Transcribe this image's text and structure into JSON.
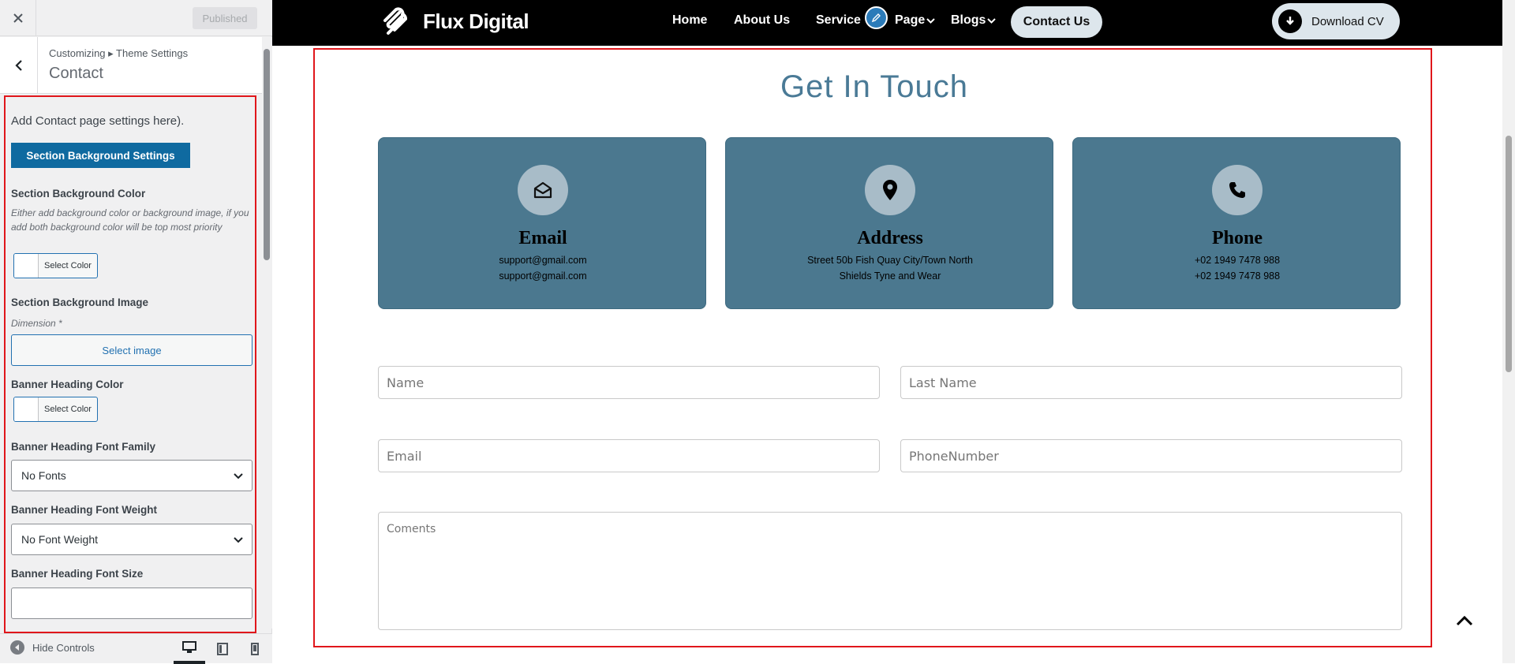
{
  "sidebar": {
    "close_icon": "close-icon",
    "published_label": "Published",
    "breadcrumb": "Customizing ▸ Theme Settings",
    "section_title": "Contact",
    "intro": "Add Contact page settings here).",
    "bg_settings_button": "Section Background Settings",
    "bg_color_label": "Section Background Color",
    "bg_color_desc": "Either add background color or background image, if you add both background color will be top most priority",
    "select_color": "Select Color",
    "bg_image_label": "Section Background Image",
    "dimension_label": "Dimension *",
    "select_image": "Select image",
    "heading_color_label": "Banner Heading Color",
    "font_family_label": "Banner Heading Font Family",
    "font_family_value": "No Fonts",
    "font_weight_label": "Banner Heading Font Weight",
    "font_weight_value": "No Font Weight",
    "font_size_label": "Banner Heading Font Size",
    "font_size_value": "",
    "hide_controls": "Hide Controls"
  },
  "nav": {
    "logo_text": "Flux Digital",
    "links": [
      "Home",
      "About Us",
      "Service",
      "Page",
      "Blogs"
    ],
    "contact": "Contact Us",
    "download": "Download CV"
  },
  "section": {
    "title": "Get In Touch",
    "cards": [
      {
        "icon": "envelope-open-icon",
        "title": "Email",
        "line1": "support@gmail.com",
        "line2": "support@gmail.com"
      },
      {
        "icon": "map-pin-icon",
        "title": "Address",
        "line1": "Street 50b Fish Quay City/Town North",
        "line2": "Shields Tyne and Wear"
      },
      {
        "icon": "phone-icon",
        "title": "Phone",
        "line1": "+02 1949 7478 988",
        "line2": "+02 1949 7478 988"
      }
    ],
    "form": {
      "name": "Name",
      "last_name": "Last Name",
      "email": "Email",
      "phone": "PhoneNumber",
      "comments": "Coments"
    }
  },
  "colors": {
    "accent_blue": "#2271b1",
    "card_bg": "#4b788f",
    "heading": "#4a7a96",
    "highlight_border": "#e0161b"
  }
}
